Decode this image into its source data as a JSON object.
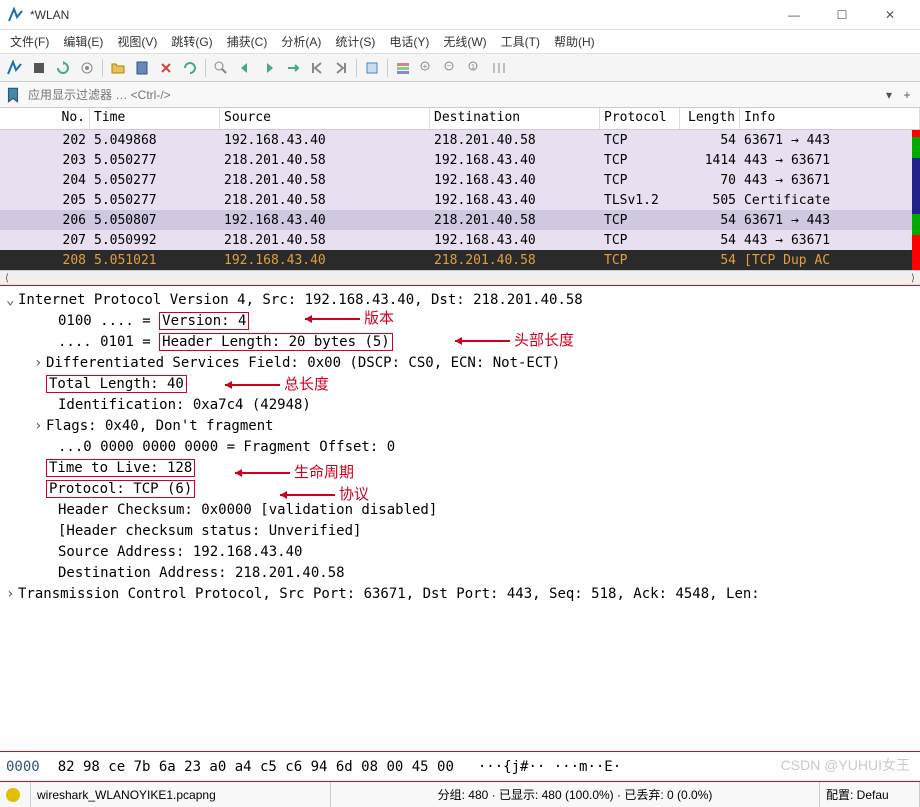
{
  "title": "*WLAN",
  "menu": [
    "文件(F)",
    "编辑(E)",
    "视图(V)",
    "跳转(G)",
    "捕获(C)",
    "分析(A)",
    "统计(S)",
    "电话(Y)",
    "无线(W)",
    "工具(T)",
    "帮助(H)"
  ],
  "filter_placeholder": "应用显示过滤器 … <Ctrl-/>",
  "columns": [
    "No.",
    "Time",
    "Source",
    "Destination",
    "Protocol",
    "Length",
    "Info"
  ],
  "packets": [
    {
      "no": "202",
      "time": "5.049868",
      "src": "192.168.43.40",
      "dst": "218.201.40.58",
      "proto": "TCP",
      "len": "54",
      "info": "63671 → 443",
      "cls": "r-purple"
    },
    {
      "no": "203",
      "time": "5.050277",
      "src": "218.201.40.58",
      "dst": "192.168.43.40",
      "proto": "TCP",
      "len": "1414",
      "info": "443 → 63671",
      "cls": "r-purple"
    },
    {
      "no": "204",
      "time": "5.050277",
      "src": "218.201.40.58",
      "dst": "192.168.43.40",
      "proto": "TCP",
      "len": "70",
      "info": "443 → 63671",
      "cls": "r-purple"
    },
    {
      "no": "205",
      "time": "5.050277",
      "src": "218.201.40.58",
      "dst": "192.168.43.40",
      "proto": "TLSv1.2",
      "len": "505",
      "info": "Certificate",
      "cls": "r-purple"
    },
    {
      "no": "206",
      "time": "5.050807",
      "src": "192.168.43.40",
      "dst": "218.201.40.58",
      "proto": "TCP",
      "len": "54",
      "info": "63671 → 443",
      "cls": "r-sel"
    },
    {
      "no": "207",
      "time": "5.050992",
      "src": "218.201.40.58",
      "dst": "192.168.43.40",
      "proto": "TCP",
      "len": "54",
      "info": "443 → 63671",
      "cls": "r-purple"
    },
    {
      "no": "208",
      "time": "5.051021",
      "src": "192.168.43.40",
      "dst": "218.201.40.58",
      "proto": "TCP",
      "len": "54",
      "info": "[TCP Dup AC",
      "cls": "r-dark"
    }
  ],
  "details": {
    "ipv4_header": "Internet Protocol Version 4, Src: 192.168.43.40, Dst: 218.201.40.58",
    "version_prefix": "0100 .... = ",
    "version_boxed": "Version: 4",
    "hlen_prefix": ".... 0101 = ",
    "hlen_boxed": "Header Length: 20 bytes (5)",
    "dsf": "Differentiated Services Field: 0x00 (DSCP: CS0, ECN: Not-ECT)",
    "totlen_boxed": "Total Length: 40",
    "ident": "Identification: 0xa7c4 (42948)",
    "flags": "Flags: 0x40, Don't fragment",
    "fragoff": "...0 0000 0000 0000 = Fragment Offset: 0",
    "ttl_boxed": "Time to Live: 128",
    "proto_boxed": "Protocol: TCP (6)",
    "checksum": "Header Checksum: 0x0000 [validation disabled]",
    "checkstat": "[Header checksum status: Unverified]",
    "srcaddr": "Source Address: 192.168.43.40",
    "dstaddr": "Destination Address: 218.201.40.58",
    "tcp": "Transmission Control Protocol, Src Port: 63671, Dst Port: 443, Seq: 518, Ack: 4548, Len:"
  },
  "annotations": {
    "version": "版本",
    "headerlen": "头部长度",
    "totallen": "总长度",
    "ttl": "生命周期",
    "protocol": "协议"
  },
  "hex": {
    "offset": "0000",
    "bytes": "82 98 ce 7b 6a 23 a0 a4  c5 c6 94 6d 08 00 45 00",
    "ascii": "···{j#·· ···m··E·"
  },
  "status": {
    "file": "wireshark_WLANOYIKE1.pcapng",
    "stats": "分组: 480 · 已显示: 480 (100.0%) · 已丢弃: 0 (0.0%)",
    "profile": "配置: Defau"
  },
  "watermark": "CSDN @YUHUI女王"
}
